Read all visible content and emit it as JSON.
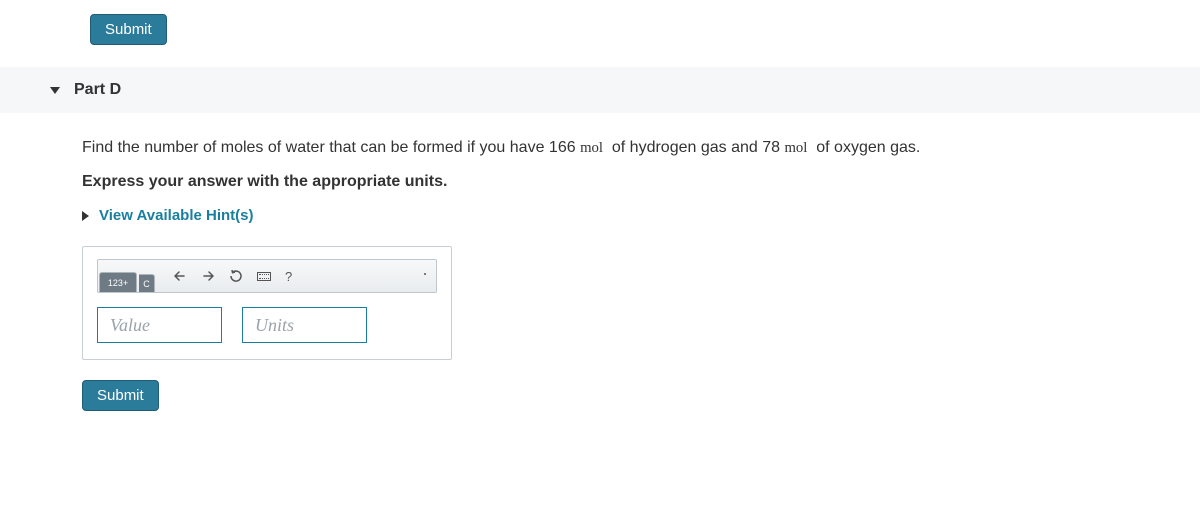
{
  "top_submit_label": "Submit",
  "part_title": "Part D",
  "question_before_val1": "Find the number of moles of water that can be formed if you have ",
  "val1": "166",
  "unit1": "mol",
  "question_mid": " of hydrogen gas and ",
  "val2": "78",
  "unit2": "mol",
  "question_after": " of oxygen gas.",
  "instruction": "Express your answer with the appropriate units.",
  "hints_label": "View Available Hint(s)",
  "toolbar": {
    "tab1": "123+",
    "tab2_symbol": "C",
    "help_icon": "?"
  },
  "value_placeholder": "Value",
  "units_placeholder": "Units",
  "bottom_submit_label": "Submit"
}
